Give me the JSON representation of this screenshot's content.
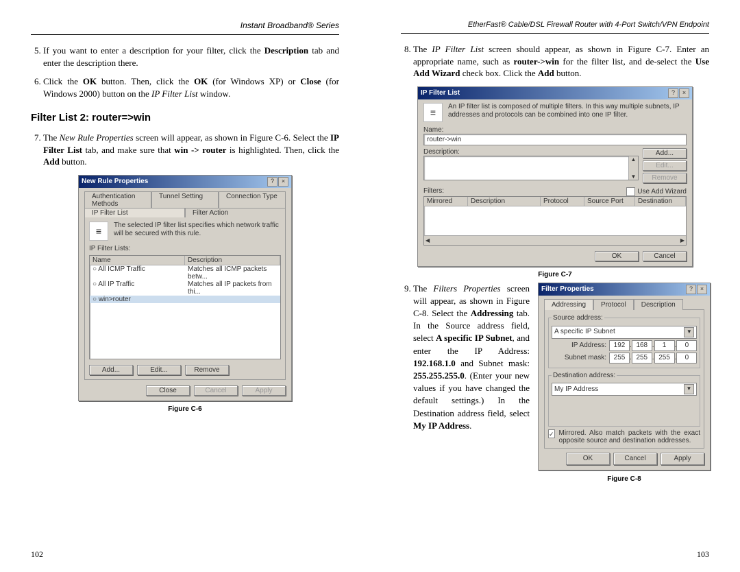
{
  "left": {
    "header": "Instant Broadband® Series",
    "page_num": "102",
    "step5_a": "If you want to enter a description for your filter, click the ",
    "step5_b": "Description",
    "step5_c": " tab and enter the description there.",
    "step6_a": "Click the ",
    "step6_b": "OK",
    "step6_c": " button. Then, click the ",
    "step6_d": "OK",
    "step6_e": " (for Windows XP) or ",
    "step6_f": "Close",
    "step6_g": " (for Windows 2000) button on the ",
    "step6_h": "IP Filter List",
    "step6_i": " window.",
    "section_heading": "Filter List 2: router=>win",
    "step7_a": "The ",
    "step7_b": "New Rule Properties",
    "step7_c": " screen will appear, as shown in Figure C-6. Select the ",
    "step7_d": "IP Filter List",
    "step7_e": " tab, and make sure that ",
    "step7_f": "win -> router",
    "step7_g": " is highlighted. Then, click the ",
    "step7_h": "Add",
    "step7_i": " button.",
    "fig_c6_caption": "Figure C-6"
  },
  "right": {
    "header": "EtherFast® Cable/DSL Firewall Router with 4-Port Switch/VPN Endpoint",
    "page_num": "103",
    "step8_a": "The ",
    "step8_b": "IP Filter List",
    "step8_c": " screen should appear, as shown in Figure C-7. Enter an appropriate name, such as ",
    "step8_d": "router->win",
    "step8_e": " for the filter list,  and de-select the ",
    "step8_f": "Use Add Wizard",
    "step8_g": " check box. Click the ",
    "step8_h": "Add",
    "step8_i": " button.",
    "fig_c7_caption": "Figure C-7",
    "step9_a": "The ",
    "step9_b": "Filters Properties",
    "step9_c": " screen will appear, as shown in Figure C-8. Select the ",
    "step9_d": "Addressing",
    "step9_e": " tab. In the Source address field, select ",
    "step9_f": "A specific IP Subnet",
    "step9_g": ", and enter the IP Address: ",
    "step9_h": "192.168.1.0",
    "step9_i": " and Subnet mask: ",
    "step9_j": "255.255.255.0",
    "step9_k": ". (Enter your new values if you have changed the default settings.) In the Destination address field, select ",
    "step9_l": "My IP Address",
    "step9_m": ".",
    "fig_c8_caption": "Figure C-8"
  },
  "dlg_c6": {
    "title": "New Rule Properties",
    "tabs_top": [
      "Authentication Methods",
      "Tunnel Setting",
      "Connection Type"
    ],
    "tabs_bottom": [
      "IP Filter List",
      "Filter Action"
    ],
    "desc": "The selected IP filter list specifies which network traffic will be secured with this rule.",
    "list_label": "IP Filter Lists:",
    "col1": "Name",
    "col2": "Description",
    "row1_name": "All ICMP Traffic",
    "row1_desc": "Matches all ICMP packets betw...",
    "row2_name": "All IP Traffic",
    "row2_desc": "Matches all IP packets from thi...",
    "row3_name": "win>router",
    "btn_add": "Add...",
    "btn_edit": "Edit...",
    "btn_remove": "Remove",
    "btn_close": "Close",
    "btn_cancel": "Cancel",
    "btn_apply": "Apply"
  },
  "dlg_c7": {
    "title": "IP Filter List",
    "desc": "An IP filter list is composed of multiple filters. In this way multiple subnets, IP addresses and protocols can be combined into one IP filter.",
    "name_label": "Name:",
    "name_value": "router->win",
    "desc_label": "Description:",
    "btn_add": "Add...",
    "btn_edit": "Edit...",
    "btn_remove": "Remove",
    "filters_label": "Filters:",
    "use_wizard": "Use Add Wizard",
    "col_mirrored": "Mirrored",
    "col_desc": "Description",
    "col_proto": "Protocol",
    "col_srcport": "Source Port",
    "col_dest": "Destination",
    "btn_ok": "OK",
    "btn_cancel": "Cancel"
  },
  "dlg_c8": {
    "title": "Filter Properties",
    "tab1": "Addressing",
    "tab2": "Protocol",
    "tab3": "Description",
    "src_group": "Source address:",
    "src_value": "A specific IP Subnet",
    "ip_label": "IP Address:",
    "subnet_label": "Subnet mask:",
    "ip": [
      "192",
      "168",
      "1",
      "0"
    ],
    "mask": [
      "255",
      "255",
      "255",
      "0"
    ],
    "dst_group": "Destination address:",
    "dst_value": "My IP Address",
    "mirrored_text": "Mirrored. Also match packets with the exact opposite source and destination addresses.",
    "btn_ok": "OK",
    "btn_cancel": "Cancel",
    "btn_apply": "Apply"
  }
}
